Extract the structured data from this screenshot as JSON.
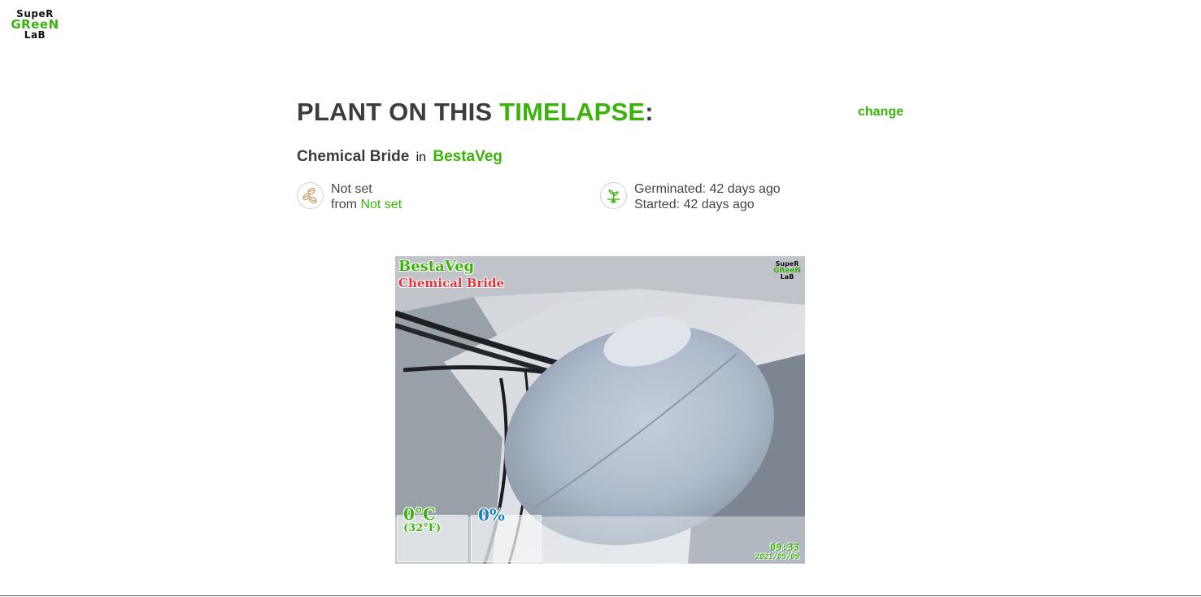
{
  "logo": {
    "line1": "SupeR",
    "line2": "GReeN",
    "line3": "LaB"
  },
  "header": {
    "title_prefix": "PLANT ON THIS ",
    "title_highlight": "TIMELAPSE",
    "title_suffix": ":",
    "change_label": "change"
  },
  "plant": {
    "name": "Chemical Bride",
    "in_label": "in",
    "box": "BestaVeg"
  },
  "strain": {
    "icon": "seeds-icon",
    "name": "Not set",
    "from_label": "from",
    "seedbank": "Not set"
  },
  "dates": {
    "icon": "sprout-icon",
    "germinated": "Germinated: 42 days ago",
    "started": "Started: 42 days ago"
  },
  "timelapse": {
    "box_name": "BestaVeg",
    "plant_name": "Chemical Bride",
    "logo": {
      "line1": "SupeR",
      "line2": "GReeN",
      "line3": "LaB"
    },
    "temperature_c": "0°C",
    "temperature_f": "(32°F)",
    "humidity": "0%",
    "time": "09:33",
    "date": "2021/05/09"
  },
  "colors": {
    "accent": "#3bb30b",
    "text": "#3c3c3c",
    "plant_overlay": "#e3333b",
    "humidity": "#1f7fc0"
  }
}
